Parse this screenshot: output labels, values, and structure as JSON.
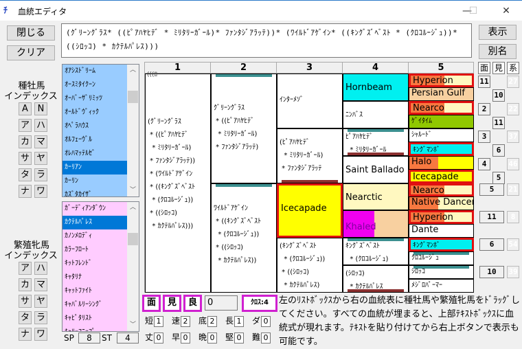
{
  "window": {
    "title": "血統エディタ",
    "minimize": "—",
    "maximize": "☐",
    "close": "✕"
  },
  "buttons": {
    "close": "閉じる",
    "clear": "クリア",
    "show": "表示",
    "alias": "別名"
  },
  "formula": {
    "value": "(ｸﾞﾘｰﾝｸﾞﾗｽ* ((ﾋﾟｱﾊﾔﾋﾃﾞ * ﾐﾘﾀﾘｰｶﾞｰﾙ)* ﾌｧﾝﾀｼﾞｱﾗｯﾃ))* (ﾜｲﾙﾄﾞｱｹﾞｲﾝ* ((ｷﾝｸﾞｽﾞﾍﾞｽﾄ * (ｸﾛｺﾙｰｼﾞｭ))* ((ｼﾛｯｺ) * ｶｸﾃﾙﾊﾟﾚｽ)))"
  },
  "sire_index": {
    "label_line1": "種牡馬",
    "label_line2": "インデックス",
    "keys": [
      "A",
      "N",
      "ア",
      "ハ",
      "カ",
      "マ",
      "サ",
      "ヤ",
      "タ",
      "ラ",
      "ナ",
      "ワ"
    ],
    "items": [
      "ｵｱｼｽﾄﾞﾘｰﾑ",
      "ｵｰｽﾐﾀｲｸｰﾝ",
      "ｵｰﾊﾞｰｻﾞﾘﾐｯﾂ",
      "ｵｰﾙﾄﾞｳﾞｨｯｸ",
      "ｵﾍﾟﾗﾊｳｽ",
      "ｵﾙﾌｪｰｳﾞﾙ",
      "ｵﾚﾊﾏｯﾃﾙｾﾞ",
      "ｶｰﾘｱﾝ",
      "ｶｰﾘﾝ",
      "ｶｽﾞﾀｶｲｻﾞ"
    ],
    "selected_index": 7
  },
  "mare_index": {
    "label_line1": "繁殖牝馬",
    "label_line2": "インデックス",
    "keys": [
      "ア",
      "ハ",
      "カ",
      "マ",
      "サ",
      "ヤ",
      "タ",
      "ラ",
      "ナ",
      "ワ"
    ],
    "items": [
      "ｶﾞｰﾃﾞｨｱﾝﾀﾞｳﾝ",
      "ｶｸﾃﾙﾊﾟﾚｽ",
      "ｶﾉﾝﾒﾛﾃﾞｨ",
      "ｶﾗｰﾌﾛｰﾄ",
      "ｷｯﾄﾌﾚﾝﾄﾞ",
      "ｷｬﾀﾘﾅ",
      "ｷｬｯﾄﾌｧｲﾄ",
      "ｷｬﾊﾞﾙﾘｰｼﾝｸﾞ",
      "ｷｬﾋﾟﾀﾘｽﾄ",
      "ｷｬﾘｰﾌﾆｯﾌﾟ"
    ],
    "selected_index": 1
  },
  "sp_st": {
    "sp_label": "SP",
    "sp_value": "8",
    "st_label": "ST",
    "st_value": "4"
  },
  "pedigree": {
    "col_headers": [
      "1",
      "2",
      "3",
      "4",
      "5"
    ],
    "col1_overflow": "(((ﾛ",
    "gen1": [
      "(ｸﾞﾘｰﾝｸﾞﾗｽ\n * ((ﾋﾟｱﾊﾔﾋﾃﾞ\n  * ﾐﾘﾀﾘｰｶﾞｰﾙ)\n * ﾌｧﾝﾀｼﾞｱﾗｯﾃ))\n * (ﾜｲﾙﾄﾞｱｹﾞｲﾝ\n * ((ｷﾝｸﾞｽﾞﾍﾞｽﾄ\n  * (ｸﾛｺﾙｰｼﾞｭ))\n * ((ｼﾛｯｺ)\n  * ｶｸﾃﾙﾊﾟﾚｽ)))"
    ],
    "gen2": [
      "ｸﾞﾘｰﾝｸﾞﾗｽ\n * ((ﾋﾟｱﾊﾔﾋﾃﾞ\n  * ﾐﾘﾀﾘｰｶﾞｰﾙ)\n * ﾌｧﾝﾀｼﾞｱﾗｯﾃ)",
      "ﾜｲﾙﾄﾞｱｹﾞｲﾝ\n * ((ｷﾝｸﾞｽﾞﾍﾞｽﾄ\n  * (ｸﾛｺﾙｰｼﾞｭ))\n * ((ｼﾛｯｺ)\n  * ｶｸﾃﾙﾊﾟﾚｽ))"
    ],
    "gen3": [
      "ｲﾝﾀｰﾒｿﾞ",
      "(ﾋﾟｱﾊﾔﾋﾃﾞ\n  * ﾐﾘﾀﾘｰｶﾞｰﾙ)\n * ﾌｧﾝﾀｼﾞｱﾗｯﾃ",
      "Icecapade",
      "(ｷﾝｸﾞｽﾞﾍﾞｽﾄ\n  * (ｸﾛｺﾙｰｼﾞｭ))\n * ((ｼﾛｯｺ)\n  * ｶｸﾃﾙﾊﾟﾚｽ)"
    ],
    "gen4": [
      "Hornbeam",
      "ﾆﾝﾊﾞｽ",
      "ﾋﾟｱﾊﾔﾋﾃﾞ\n  * ﾐﾘﾀﾘｰｶﾞｰﾙ",
      "Saint Ballado",
      "Nearctic",
      "Khaled",
      "ｷﾝｸﾞｽﾞﾍﾞｽﾄ\n  * (ｸﾛｺﾙｰｼﾞｭ)",
      "(ｼﾛｯｺ)\n  * ｶｸﾃﾙﾊﾟﾚｽ"
    ],
    "gen5": [
      "Hyperion",
      "Persian Gulf",
      "Nearco",
      "ｹﾞｲﾀｲﾑ",
      "ｼｬﾙｰﾄﾞ",
      "ｷﾝｸﾞﾏﾝﾎﾞ",
      "Halo",
      "Icecapade",
      "Nearco",
      "Native Dancer",
      "Hyperion",
      "Dante",
      "ｷﾝｸﾞﾏﾝﾎﾞ",
      "ｸﾛｺﾙｰｼﾞｭ",
      "ｼﾛｯｺ",
      "ﾒｼﾞﾛﾊﾟｰﾏｰ"
    ],
    "colors": {
      "cyan": "#00f0f0",
      "yellow": "#ffff00",
      "light_yellow": "#fff8c0",
      "peach": "#f8d0a0",
      "orange": "#f87840",
      "lime": "#90c800",
      "magenta": "#f000f0",
      "red_frame": "#e01010",
      "teal_bar": "#3c9090",
      "maroon_bar": "#8b3030"
    }
  },
  "side_panel": {
    "headers": [
      "面",
      "見",
      "系"
    ],
    "men": [
      "11",
      "2",
      "3",
      "4"
    ],
    "ken": [
      "10",
      "11",
      "6",
      "5"
    ],
    "kei": [
      "27",
      "22",
      "37",
      "46"
    ],
    "lower": [
      {
        "men": "5",
        "kei": "21"
      },
      {
        "men": "11",
        "kei": "8"
      },
      {
        "men": "6",
        "kei": "54"
      },
      {
        "men": "10",
        "kei": "39"
      }
    ]
  },
  "bottom": {
    "men": "面",
    "ken": "見",
    "ryo": "良",
    "value": "0",
    "cross": "ｸﾛｽ:4",
    "stats_row1": [
      {
        "label": "短",
        "value": "1"
      },
      {
        "label": "速",
        "value": "2"
      },
      {
        "label": "底",
        "value": "2"
      },
      {
        "label": "長",
        "value": "1"
      },
      {
        "label": "ダ",
        "value": "0"
      }
    ],
    "stats_row2": [
      {
        "label": "丈",
        "value": "0"
      },
      {
        "label": "早",
        "value": "0"
      },
      {
        "label": "晩",
        "value": "0"
      },
      {
        "label": "堅",
        "value": "0"
      },
      {
        "label": "難",
        "value": "0"
      }
    ],
    "help": "左のﾘｽﾄﾎﾞｯｸｽから右の血統表に種牡馬や繁殖牝馬をﾄﾞﾗｯｸﾞしてください。すべての血統が埋まると、上部ﾃｷｽﾄﾎﾞｯｸｽに血統式が現れます。ﾃｷｽﾄを貼り付けてから右上ボタンで表示も可能です。"
  }
}
